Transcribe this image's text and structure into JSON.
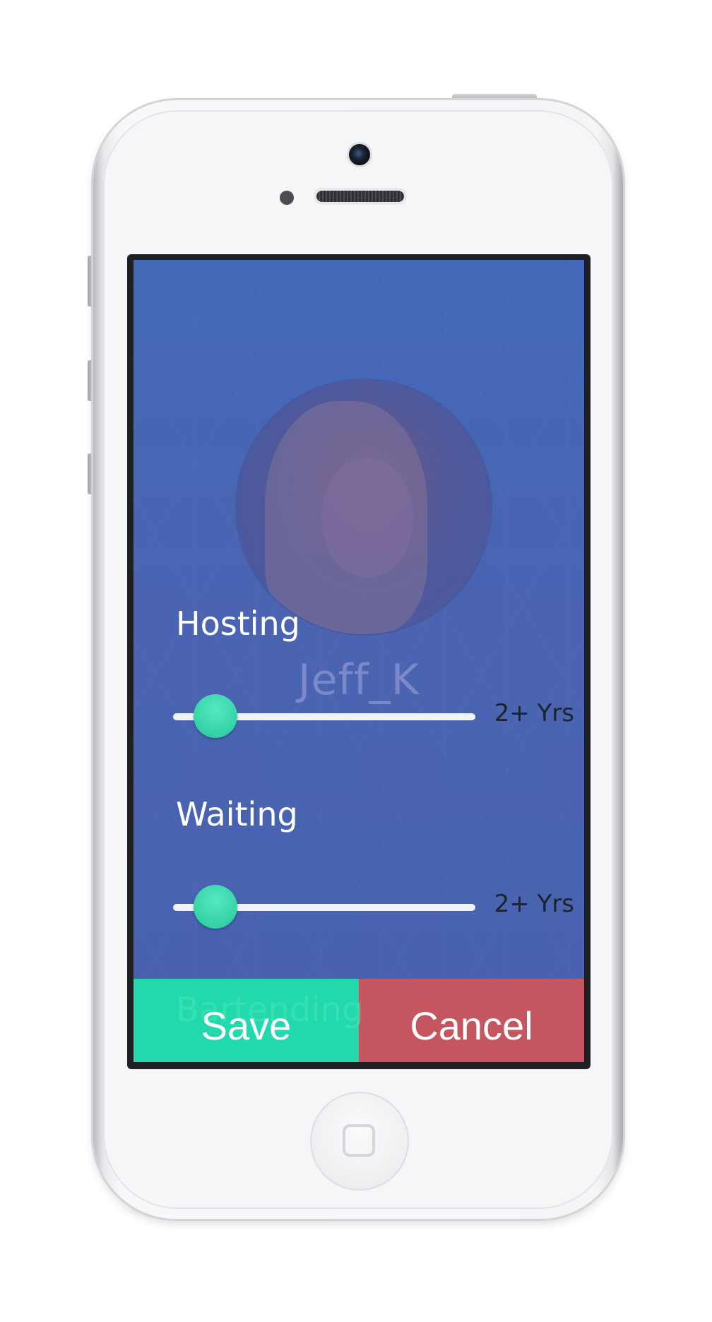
{
  "profile": {
    "username": "Jeff_K"
  },
  "skills": [
    {
      "label": "Hosting",
      "value_text": "2+ Yrs",
      "level": 0.14
    },
    {
      "label": "Waiting",
      "value_text": "2+ Yrs",
      "level": 0.14
    }
  ],
  "hidden_section": {
    "label": "Bartending"
  },
  "actions": {
    "save_label": "Save",
    "cancel_label": "Cancel"
  },
  "colors": {
    "screen_background": "#4766b4",
    "slider_thumb": "#33d3a6",
    "save_button": "#22d9ad",
    "cancel_button": "#c55660",
    "phone_body": "#f5f6f8"
  },
  "icons": {
    "camera": "front-camera-icon",
    "speaker": "earpiece-speaker-icon",
    "home": "home-button-icon"
  }
}
